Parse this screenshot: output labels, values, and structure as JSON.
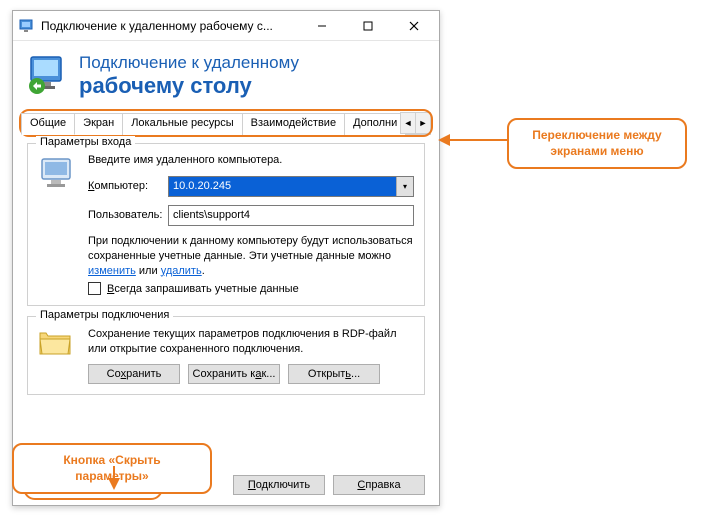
{
  "titlebar": {
    "text": "Подключение к удаленному рабочему с..."
  },
  "header": {
    "line1": "Подключение к удаленному",
    "line2": "рабочему столу"
  },
  "tabs": {
    "items": [
      "Общие",
      "Экран",
      "Локальные ресурсы",
      "Взаимодействие",
      "Дополни"
    ]
  },
  "login": {
    "group_title": "Параметры входа",
    "intro": "Введите имя удаленного компьютера.",
    "computer_label": "Компьютер:",
    "computer_value": "10.0.20.245",
    "user_label": "Пользователь:",
    "user_value": "clients\\support4",
    "cred_text_1": "При подключении к данному компьютеру будут использоваться сохраненные учетные данные. Эти учетные данные можно ",
    "cred_link_edit": "изменить",
    "cred_text_2": " или ",
    "cred_link_delete": "удалить",
    "cred_text_3": ".",
    "always_ask": "Всегда запрашивать учетные данные"
  },
  "conn": {
    "group_title": "Параметры подключения",
    "text": "Сохранение текущих параметров подключения в RDP-файл или открытие сохраненного подключения.",
    "save": "Сохранить",
    "save_as": "Сохранить как...",
    "open": "Открыть..."
  },
  "bottom": {
    "hide": "Скрыть параметры",
    "connect": "Подключить",
    "help": "Справка"
  },
  "callouts": {
    "tabs": "Переключение между экранами меню",
    "hide": "Кнопка «Скрыть параметры»"
  }
}
